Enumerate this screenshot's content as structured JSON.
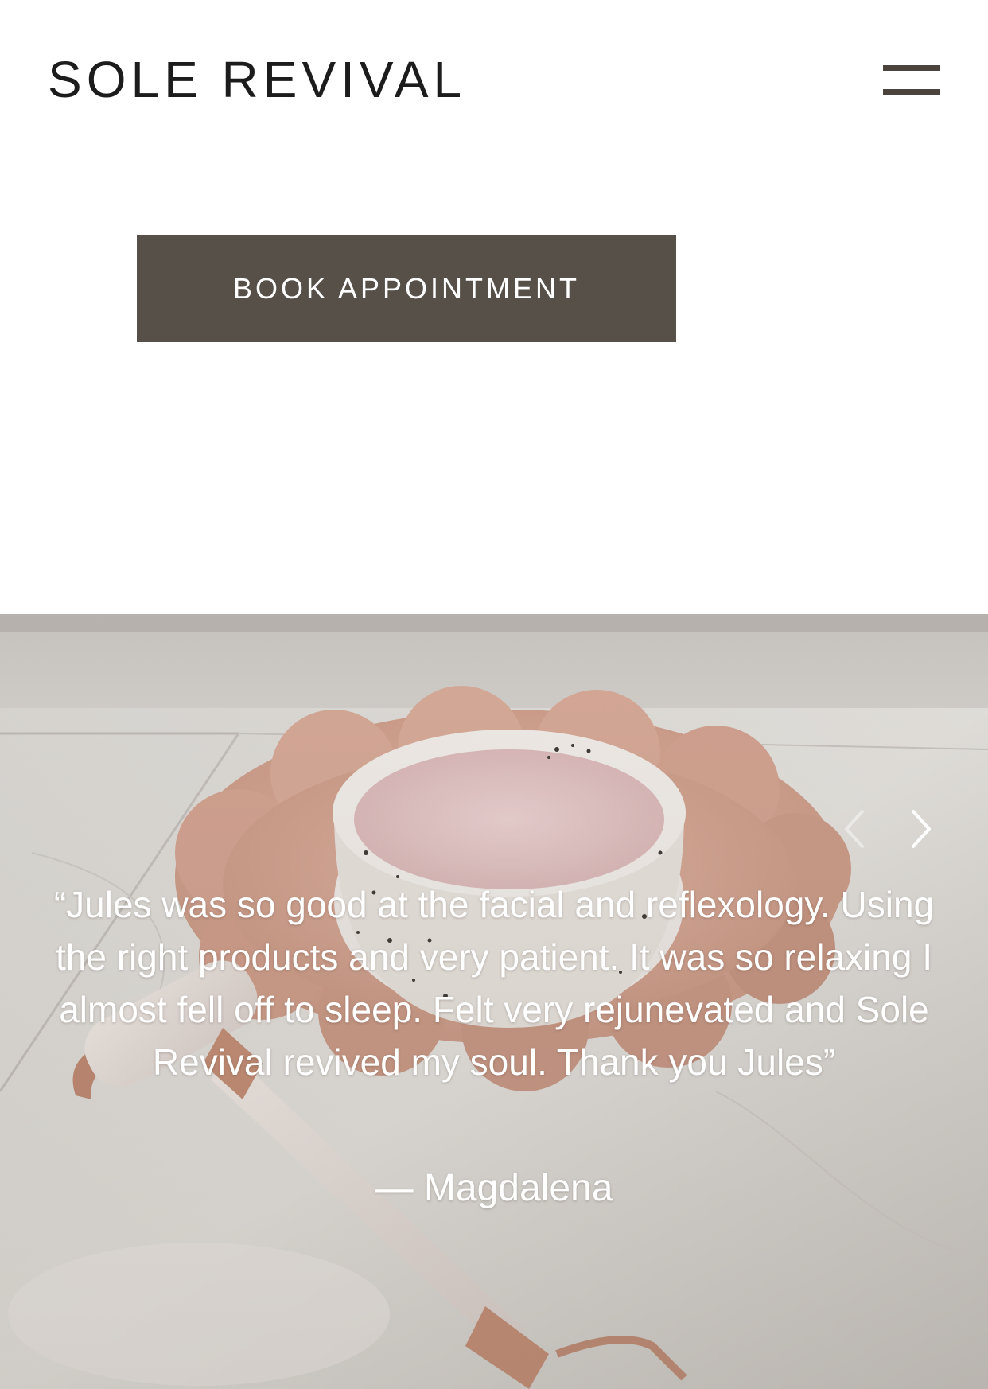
{
  "header": {
    "brand": "SOLE REVIVAL",
    "menu_icon": "hamburger-menu-icon"
  },
  "cta": {
    "book_label": "BOOK APPOINTMENT"
  },
  "testimonial": {
    "quote": "“Jules was so good at the facial and reflexology. Using the right products and very patient. It was so relaxing I almost fell off to sleep. Felt very rejunevated and Sole Revival revived my soul. Thank you Jules”",
    "author": "— Magdalena",
    "prev_icon": "chevron-left-icon",
    "next_icon": "chevron-right-icon"
  },
  "colors": {
    "button_bg": "#575049",
    "menu_icon": "#4b433d",
    "text_dark": "#1c1c1c",
    "dish": "#d9aa98",
    "cream": "#e6c9c9"
  }
}
